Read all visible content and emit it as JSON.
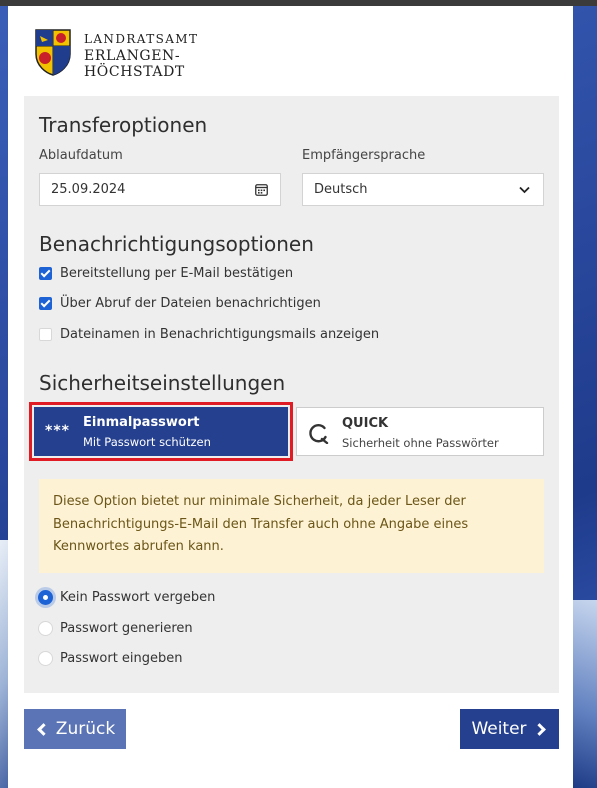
{
  "logo": {
    "line1": "LANDRATSAMT",
    "line2": "ERLANGEN-HÖCHSTADT"
  },
  "transfer": {
    "heading": "Transferoptionen",
    "expiry_label": "Ablaufdatum",
    "expiry_value": "25.09.2024",
    "language_label": "Empfängersprache",
    "language_value": "Deutsch"
  },
  "notifications": {
    "heading": "Benachrichtigungsoptionen",
    "items": [
      {
        "label": "Bereitstellung per E-Mail bestätigen",
        "checked": true
      },
      {
        "label": "Über Abruf der Dateien benachrichtigen",
        "checked": true
      },
      {
        "label": "Dateinamen in Benachrichtigungsmails anzeigen",
        "checked": false
      }
    ]
  },
  "security": {
    "heading": "Sicherheitseinstellungen",
    "option_onetime": {
      "stars": "***",
      "title": "Einmalpasswort",
      "subtitle": "Mit Passwort schützen"
    },
    "option_quick": {
      "title": "QUICK",
      "subtitle": "Sicherheit ohne Passwörter"
    },
    "warning": "Diese Option bietet nur minimale Sicherheit, da jeder Leser der Benachrichtigungs-E-Mail den Transfer auch ohne Angabe eines Kennwortes abrufen kann.",
    "radios": [
      {
        "label": "Kein Passwort vergeben",
        "selected": true
      },
      {
        "label": "Passwort generieren",
        "selected": false
      },
      {
        "label": "Passwort eingeben",
        "selected": false
      }
    ]
  },
  "nav": {
    "back_label": "Zurück",
    "next_label": "Weiter"
  },
  "colors": {
    "primary": "#25408f",
    "back_button": "#5b74b5",
    "checkbox": "#1e63d6",
    "highlight": "#e01b24",
    "warning_bg": "#fdf3d4"
  }
}
